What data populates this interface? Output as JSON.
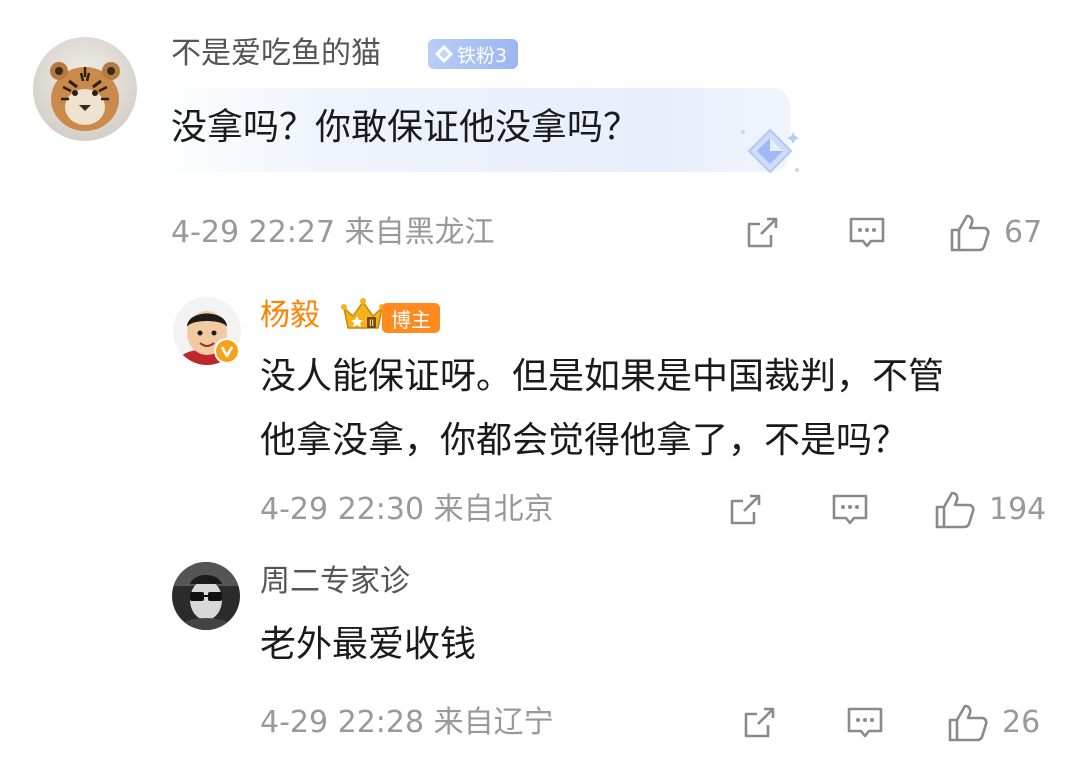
{
  "comments": [
    {
      "username": "不是爱吃鱼的猫",
      "fan_badge": "铁粉3",
      "text": "没拿吗？你敢保证他没拿吗？",
      "meta": "4-29 22:27 来自黑龙江",
      "likes": "67"
    },
    {
      "username": "杨毅",
      "blogger_badge": "博主",
      "text_lines": [
        "没人能保证呀。但是如果是中国裁判，不管",
        "他拿没拿，你都会觉得他拿了，不是吗？"
      ],
      "meta": "4-29 22:30 来自北京",
      "likes": "194"
    },
    {
      "username": "周二专家诊",
      "text": "老外最爱收钱",
      "meta": "4-29 22:28 来自辽宁",
      "likes": "26"
    }
  ],
  "colors": {
    "username": "#555555",
    "blogger": "#ff8200",
    "meta": "#999999",
    "text": "#1a1a1a",
    "fan_badge": "#9bb6f2"
  },
  "icons": [
    "forward-icon",
    "comment-icon",
    "like-icon",
    "diamond-icon",
    "crown-icon",
    "verified-icon"
  ]
}
